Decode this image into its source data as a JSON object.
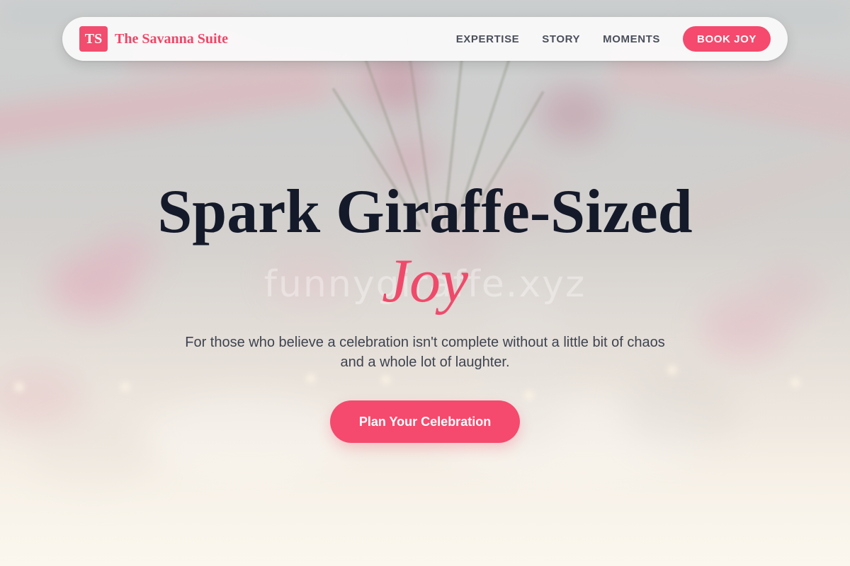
{
  "brand": {
    "logo_initials": "TS",
    "name": "The Savanna Suite"
  },
  "nav": {
    "links": [
      {
        "label": "EXPERTISE"
      },
      {
        "label": "STORY"
      },
      {
        "label": "MOMENTS"
      }
    ],
    "cta_label": "BOOK JOY"
  },
  "hero": {
    "title_line": "Spark Giraffe-Sized",
    "title_accent": "Joy",
    "subtitle": "For those who believe a celebration isn't complete without a little bit of chaos and a whole lot of laughter.",
    "cta_label": "Plan Your Celebration",
    "watermark": "funnygiraffe.xyz"
  },
  "colors": {
    "accent": "#f54a6d",
    "brand_text": "#f04668",
    "title_text": "#141a2a",
    "body_text": "#3e4350",
    "nav_text": "#4a4f5c"
  },
  "background": {
    "description_icon": "blurred-flower-centerpiece-image"
  }
}
